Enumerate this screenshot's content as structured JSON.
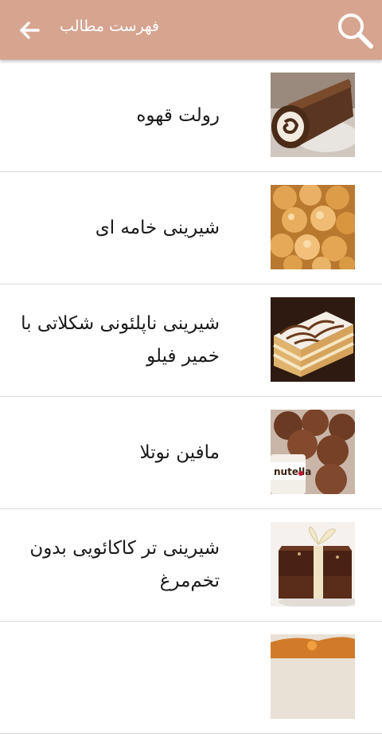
{
  "app_bar": {
    "title": "فهرست مطالب",
    "search_icon": "search-icon",
    "back_icon": "arrow-back-icon",
    "color": "#d6a48f"
  },
  "items": [
    {
      "label": "رولت قهوه",
      "thumb": "coffee-roll-cake"
    },
    {
      "label": "شیرینی خامه ای",
      "thumb": "cream-puff-pastries"
    },
    {
      "label": "شیرینی ناپلئونی شکلاتی با خمیر فیلو",
      "thumb": "chocolate-napoleon-slice"
    },
    {
      "label": "مافین نوتلا",
      "thumb": "nutella-muffins"
    },
    {
      "label": "شیرینی تر کاکائویی بدون تخم‌مرغ",
      "thumb": "cocoa-cake-with-ribbon"
    },
    {
      "label": "",
      "thumb": "orange-cake"
    }
  ]
}
